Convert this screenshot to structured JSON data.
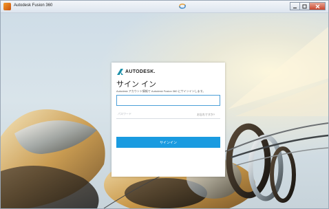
{
  "window": {
    "title": "Autodesk Fusion 360",
    "app_icon": "fusion-app-icon",
    "center_icon": "sync-glyph-icon",
    "controls": [
      "minimize-icon",
      "maximize-icon",
      "close-icon"
    ]
  },
  "signin": {
    "brand": "AUTODESK.",
    "heading": "サイン イン",
    "subtitle": "Autodesk アカウント情報で Autodesk Fusion 360 にサインインします。",
    "email_value": "",
    "password_placeholder": "パスワード",
    "forgot_label": "お忘れですか?",
    "button_label": "サインイン"
  },
  "colors": {
    "accent": "#1a9be0",
    "input_focus": "#4b9fd8",
    "titlebar": "#dde5ee"
  }
}
